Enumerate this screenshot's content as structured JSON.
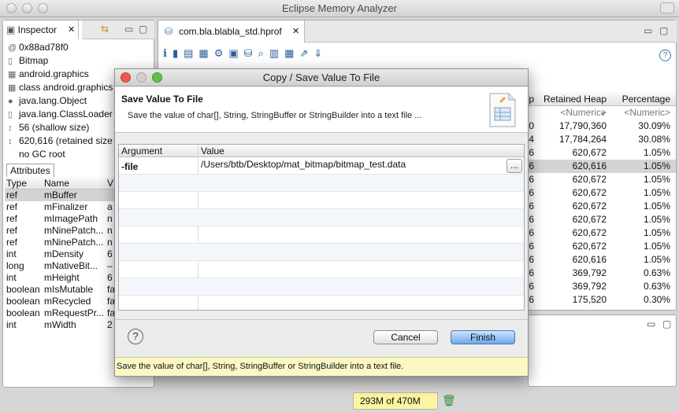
{
  "window": {
    "title": "Eclipse Memory Analyzer"
  },
  "inspector": {
    "tab_label": "Inspector",
    "items": [
      {
        "icon": "at-icon",
        "glyph": "@",
        "text": "0x88ad78f0"
      },
      {
        "icon": "file-icon",
        "glyph": "▯",
        "text": "Bitmap"
      },
      {
        "icon": "package-icon",
        "glyph": "▦",
        "text": "android.graphics"
      },
      {
        "icon": "package-icon",
        "glyph": "▦",
        "text": "class android.graphics"
      },
      {
        "icon": "class-icon",
        "glyph": "●",
        "text": "java.lang.Object"
      },
      {
        "icon": "classloader-icon",
        "glyph": "▯",
        "text": "java.lang.ClassLoader"
      },
      {
        "icon": "size-icon",
        "glyph": "↕",
        "text": "56 (shallow size)"
      },
      {
        "icon": "size-icon",
        "glyph": "↕",
        "text": "620,616 (retained size"
      },
      {
        "icon": "",
        "glyph": "",
        "text": "no GC root"
      }
    ],
    "attributes_tab": "Attributes",
    "attr_headers": [
      "Type",
      "Name",
      "V"
    ],
    "attributes": [
      {
        "type": "ref",
        "name": "mBuffer",
        "value": ""
      },
      {
        "type": "ref",
        "name": "mFinalizer",
        "value": "a"
      },
      {
        "type": "ref",
        "name": "mImagePath",
        "value": "n"
      },
      {
        "type": "ref",
        "name": "mNinePatch...",
        "value": "n"
      },
      {
        "type": "ref",
        "name": "mNinePatch...",
        "value": "n"
      },
      {
        "type": "int",
        "name": "mDensity",
        "value": "6"
      },
      {
        "type": "long",
        "name": "mNativeBit...",
        "value": "–"
      },
      {
        "type": "int",
        "name": "mHeight",
        "value": "6"
      },
      {
        "type": "boolean",
        "name": "mIsMutable",
        "value": "fa"
      },
      {
        "type": "boolean",
        "name": "mRecycled",
        "value": "fa"
      },
      {
        "type": "boolean",
        "name": "mRequestPr...",
        "value": "fa"
      },
      {
        "type": "int",
        "name": "mWidth",
        "value": "2"
      }
    ]
  },
  "editor": {
    "tab_label": "com.bla.blabla_std.hprof",
    "table": {
      "headers": [
        "p",
        "Retained Heap",
        "Percentage"
      ],
      "filter": [
        "<Numeric>",
        "<Numeric>"
      ],
      "rows": [
        {
          "lead": "0",
          "retained": "17,790,360",
          "pct": "30.09%"
        },
        {
          "lead": "4",
          "retained": "17,784,264",
          "pct": "30.08%"
        },
        {
          "lead": "6",
          "retained": "620,672",
          "pct": "1.05%"
        },
        {
          "lead": "6",
          "retained": "620,616",
          "pct": "1.05%"
        },
        {
          "lead": "6",
          "retained": "620,672",
          "pct": "1.05%"
        },
        {
          "lead": "6",
          "retained": "620,672",
          "pct": "1.05%"
        },
        {
          "lead": "6",
          "retained": "620,672",
          "pct": "1.05%"
        },
        {
          "lead": "6",
          "retained": "620,672",
          "pct": "1.05%"
        },
        {
          "lead": "6",
          "retained": "620,672",
          "pct": "1.05%"
        },
        {
          "lead": "6",
          "retained": "620,672",
          "pct": "1.05%"
        },
        {
          "lead": "6",
          "retained": "620,616",
          "pct": "1.05%"
        },
        {
          "lead": "6",
          "retained": "369,792",
          "pct": "0.63%"
        },
        {
          "lead": "6",
          "retained": "369,792",
          "pct": "0.63%"
        },
        {
          "lead": "6",
          "retained": "175,520",
          "pct": "0.30%"
        }
      ]
    }
  },
  "statusbar": {
    "heap": "293M of 470M"
  },
  "dialog": {
    "title": "Copy / Save Value To File",
    "heading": "Save Value To File",
    "description": "Save the value of char[], String, StringBuffer or StringBuilder into a text file ...",
    "columns": [
      "Argument",
      "Value"
    ],
    "args": [
      {
        "name": "-file",
        "value": "/Users/btb/Desktop/mat_bitmap/bitmap_test.data"
      }
    ],
    "browse_label": "...",
    "cancel_label": "Cancel",
    "finish_label": "Finish",
    "status": "Save the value of char[], String, StringBuffer or StringBuilder into a text file."
  }
}
